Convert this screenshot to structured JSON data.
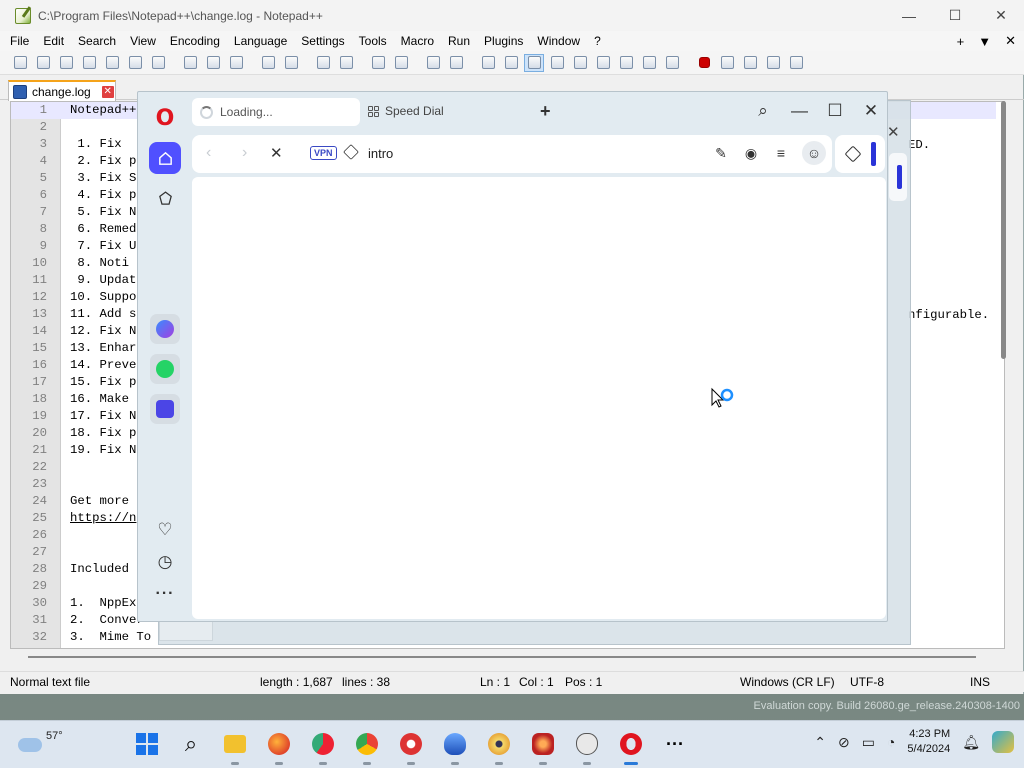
{
  "npp": {
    "title": "C:\\Program Files\\Notepad++\\change.log - Notepad++",
    "menu": [
      "File",
      "Edit",
      "Search",
      "View",
      "Encoding",
      "Language",
      "Settings",
      "Tools",
      "Macro",
      "Run",
      "Plugins",
      "Window",
      "?"
    ],
    "menu_right": [
      "+",
      "▼",
      "✕"
    ],
    "tab_label": "change.log",
    "lines": [
      {
        "n": "1",
        "t": "Notepad++"
      },
      {
        "n": "2",
        "t": ""
      },
      {
        "n": "3",
        "t": " 1. Fix "
      },
      {
        "n": "4",
        "t": " 2. Fix p"
      },
      {
        "n": "5",
        "t": " 3. Fix S"
      },
      {
        "n": "6",
        "t": " 4. Fix p"
      },
      {
        "n": "7",
        "t": " 5. Fix N"
      },
      {
        "n": "8",
        "t": " 6. Remed"
      },
      {
        "n": "9",
        "t": " 7. Fix U"
      },
      {
        "n": "10",
        "t": " 8. Noti"
      },
      {
        "n": "11",
        "t": " 9. Updat"
      },
      {
        "n": "12",
        "t": "10. Suppo"
      },
      {
        "n": "13",
        "t": "11. Add s"
      },
      {
        "n": "14",
        "t": "12. Fix N"
      },
      {
        "n": "15",
        "t": "13. Enhar"
      },
      {
        "n": "16",
        "t": "14. Preve"
      },
      {
        "n": "17",
        "t": "15. Fix p"
      },
      {
        "n": "18",
        "t": "16. Make"
      },
      {
        "n": "19",
        "t": "17. Fix N"
      },
      {
        "n": "20",
        "t": "18. Fix p"
      },
      {
        "n": "21",
        "t": "19. Fix N"
      },
      {
        "n": "22",
        "t": ""
      },
      {
        "n": "23",
        "t": ""
      },
      {
        "n": "24",
        "t": "Get more "
      },
      {
        "n": "25",
        "t": "https://n"
      },
      {
        "n": "26",
        "t": ""
      },
      {
        "n": "27",
        "t": ""
      },
      {
        "n": "28",
        "t": "Included "
      },
      {
        "n": "29",
        "t": ""
      },
      {
        "n": "30",
        "t": "1.  NppEx"
      },
      {
        "n": "31",
        "t": "2.  Conver"
      },
      {
        "n": "32",
        "t": "3.  Mime To"
      }
    ],
    "right_fragments": {
      "line3": "ED.",
      "line13": "nfigurable."
    },
    "status": {
      "type": "Normal text file",
      "length": "length : 1,687",
      "lines": "lines : 38",
      "ln": "Ln : 1",
      "col": "Col : 1",
      "pos": "Pos : 1",
      "eol": "Windows (CR LF)",
      "encoding": "UTF-8",
      "mode": "INS"
    }
  },
  "eval_text": "Evaluation copy. Build 26080.ge_release.240308-1400",
  "opera": {
    "tab_loading": "Loading...",
    "tab_speed_dial": "Speed Dial",
    "vpn": "VPN",
    "url": "intro",
    "accent": "#5050ff"
  },
  "taskbar": {
    "temperature": "57°",
    "time": "4:23 PM",
    "date": "5/4/2024"
  }
}
